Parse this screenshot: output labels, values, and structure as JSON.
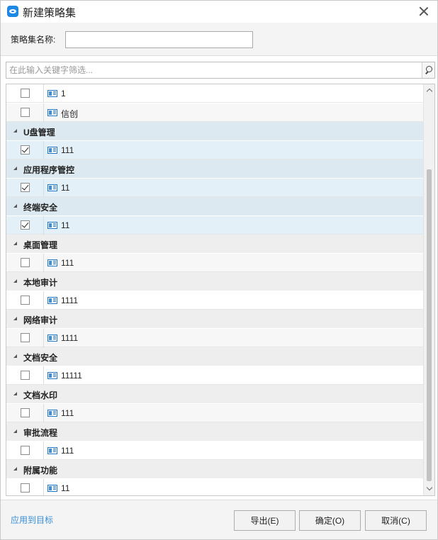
{
  "window": {
    "title": "新建策略集",
    "close_label": "关闭"
  },
  "name_field": {
    "label": "策略集名称:",
    "value": ""
  },
  "filter": {
    "placeholder": "在此输入关键字筛选..."
  },
  "list": {
    "rows": [
      {
        "type": "item",
        "label": "1",
        "checked": false,
        "highlighted": false,
        "alt": false
      },
      {
        "type": "item",
        "label": "信创",
        "checked": false,
        "highlighted": false,
        "alt": true
      },
      {
        "type": "group",
        "label": "U盘管理",
        "highlighted": true
      },
      {
        "type": "item",
        "label": "111",
        "checked": true,
        "highlighted": true
      },
      {
        "type": "group",
        "label": "应用程序管控",
        "highlighted": true
      },
      {
        "type": "item",
        "label": "11",
        "checked": true,
        "highlighted": true
      },
      {
        "type": "group",
        "label": "终端安全",
        "highlighted": true
      },
      {
        "type": "item",
        "label": "11",
        "checked": true,
        "highlighted": true
      },
      {
        "type": "group",
        "label": "桌面管理",
        "highlighted": false
      },
      {
        "type": "item",
        "label": "111",
        "checked": false,
        "highlighted": false,
        "alt": true
      },
      {
        "type": "group",
        "label": "本地审计",
        "highlighted": false
      },
      {
        "type": "item",
        "label": "1111",
        "checked": false,
        "highlighted": false,
        "alt": false
      },
      {
        "type": "group",
        "label": "网络审计",
        "highlighted": false
      },
      {
        "type": "item",
        "label": "1111",
        "checked": false,
        "highlighted": false,
        "alt": true
      },
      {
        "type": "group",
        "label": "文档安全",
        "highlighted": false
      },
      {
        "type": "item",
        "label": "11111",
        "checked": false,
        "highlighted": false,
        "alt": false
      },
      {
        "type": "group",
        "label": "文档水印",
        "highlighted": false
      },
      {
        "type": "item",
        "label": "111",
        "checked": false,
        "highlighted": false,
        "alt": true
      },
      {
        "type": "group",
        "label": "审批流程",
        "highlighted": false
      },
      {
        "type": "item",
        "label": "111",
        "checked": false,
        "highlighted": false,
        "alt": false
      },
      {
        "type": "group",
        "label": "附属功能",
        "highlighted": false
      },
      {
        "type": "item",
        "label": "11",
        "checked": false,
        "highlighted": false,
        "alt": false
      }
    ]
  },
  "footer": {
    "apply_link": "应用到目标",
    "export_label": "导出(E)",
    "ok_label": "确定(O)",
    "cancel_label": "取消(C)"
  },
  "colors": {
    "accent": "#1e88e5",
    "link": "#3a8fd6",
    "selected_row": "#e3f0f8",
    "group_row": "#eeeeee"
  }
}
